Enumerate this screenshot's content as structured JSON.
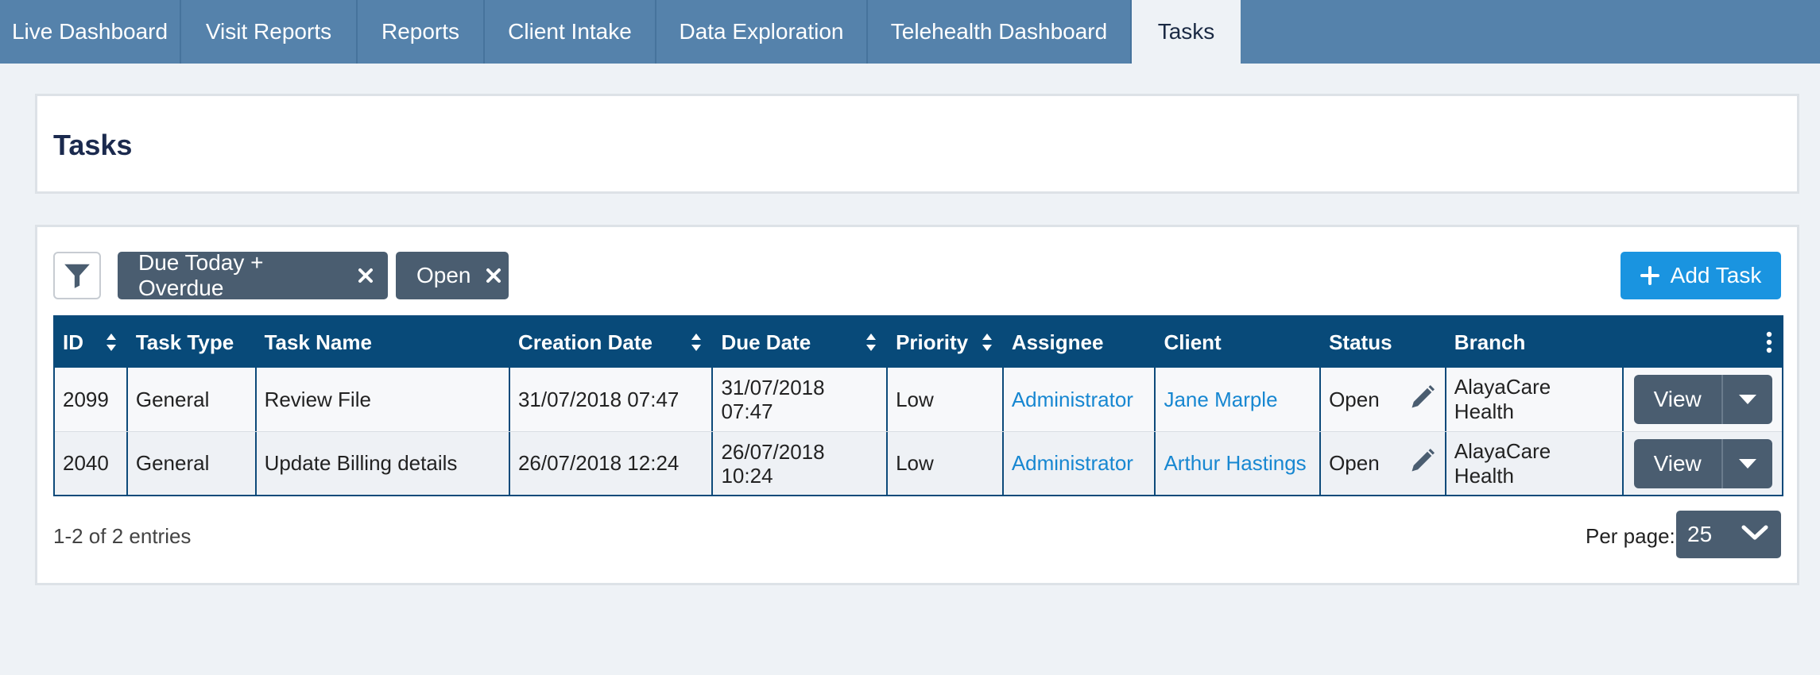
{
  "tabs": [
    {
      "label": "Live Dashboard",
      "active": false
    },
    {
      "label": "Visit Reports",
      "active": false
    },
    {
      "label": "Reports",
      "active": false
    },
    {
      "label": "Client Intake",
      "active": false
    },
    {
      "label": "Data Exploration",
      "active": false
    },
    {
      "label": "Telehealth Dashboard",
      "active": false
    },
    {
      "label": "Tasks",
      "active": true
    }
  ],
  "page": {
    "title": "Tasks"
  },
  "filters": {
    "icon": "filter-icon",
    "chips": [
      {
        "label": "Due Today + Overdue",
        "icon": "close-icon"
      },
      {
        "label": "Open",
        "icon": "close-icon"
      }
    ]
  },
  "add_task": {
    "label": "Add Task",
    "icon": "plus-icon"
  },
  "table": {
    "headers": {
      "id": "ID",
      "task_type": "Task Type",
      "task_name": "Task Name",
      "creation_date": "Creation Date",
      "due_date": "Due Date",
      "priority": "Priority",
      "assignee": "Assignee",
      "client": "Client",
      "status": "Status",
      "branch": "Branch"
    },
    "rows": [
      {
        "id": "2099",
        "task_type": "General",
        "task_name": "Review File",
        "creation_date": "31/07/2018 07:47",
        "due_date": "31/07/2018 07:47",
        "priority": "Low",
        "assignee": "Administrator",
        "client": "Jane Marple",
        "status": "Open",
        "branch": "AlayaCare Health",
        "action": "View"
      },
      {
        "id": "2040",
        "task_type": "General",
        "task_name": "Update Billing details",
        "creation_date": "26/07/2018 12:24",
        "due_date": "26/07/2018 10:24",
        "priority": "Low",
        "assignee": "Administrator",
        "client": "Arthur Hastings",
        "status": "Open",
        "branch": "AlayaCare Health",
        "action": "View"
      }
    ]
  },
  "footer": {
    "entries": "1-2 of 2 entries",
    "per_page_label": "Per page:",
    "per_page_value": "25"
  },
  "colors": {
    "tabbar": "#5582ab",
    "table_header": "#084a79",
    "primary": "#1a94e0",
    "chip": "#4a5d70",
    "link": "#1787d1"
  }
}
